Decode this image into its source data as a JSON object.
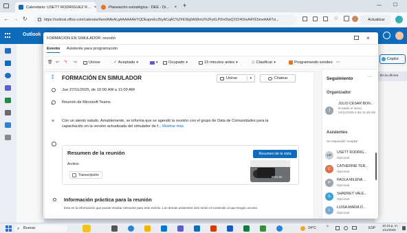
{
  "browser": {
    "tabs": [
      {
        "label": "Calendario: USETT RODRIGUEZ R…",
        "color": "#0f6cbd"
      },
      {
        "label": "Planeación estratégica - DEE - Di…",
        "color": "#e8731d"
      }
    ],
    "new_tab_glyph": "+",
    "window_controls": [
      "—",
      "☐"
    ],
    "url": "https://outlook.office.com/calendar/item/AAkALgAAAAAAHYQDEapmEv2byACqAC%2FEWg0A68mU%2FyKLP0mI5wQ15240XeAAYE5meAAA?ui...",
    "update_button": "Actualizar"
  },
  "outlook": {
    "app_name": "Outlook",
    "copilot_label": "Copilot",
    "office_label": "En la oficina"
  },
  "modal": {
    "title": "FORMACIÓN EN SIMULADOR: reunión",
    "tabs": [
      "Evento",
      "Asistente para programación"
    ],
    "toolbar": {
      "unirse": "Unirse",
      "aceptado": "Aceptado",
      "ocupado": "Ocupado",
      "recordatorio": "15 minutos antes",
      "clasificar": "Clasificar",
      "programando": "Programando sondeo",
      "more": "···"
    },
    "event_title": "FORMACIÓN EN SIMULADOR",
    "join_button": "Unirse",
    "chat_button": "Chatear",
    "datetime": "Jue 27/11/2025, de 10:00 AM a 11:00 AM",
    "location": "Reunión de Microsoft Teams",
    "body": "Con un atento saludo. Amablemente, se informa que se agendó la reunión con el grupo de Data de Comunidades para la capacitación en la versión actualizada del simulador de f...",
    "more_link": "Mostrar más",
    "recap": {
      "title": "Resumen de la reunión",
      "view_button": "Resumen de la vista",
      "files_label": "Archivo",
      "transcript_label": "Transcripción",
      "duration": "50m 4s"
    },
    "info": {
      "title": "Información práctica para la reunión",
      "text": "Esta es la información que puede resultar relevante para este evento. Los demás asistentes solo verán el contenido al que tengan acceso."
    }
  },
  "sidebar": {
    "title": "Seguimiento",
    "organizer_label": "Organizador",
    "organizer": {
      "initials": "J",
      "name": "JULIO CESAR BON...",
      "sent": "Enviado el lunes, 24/11/2025 a las 11:48 AM"
    },
    "attendees_label": "Asistentes",
    "attendees_sub": "Se respondió 'Aceptar'",
    "attendees": [
      {
        "initials": "UR",
        "name": "USETT RODRIG...",
        "role": "Opcional",
        "color": "#c7cdd4"
      },
      {
        "initials": "C",
        "name": "CATHERINE TER...",
        "role": "Opcional",
        "color": "#d8734c"
      },
      {
        "initials": "P",
        "name": "PAOLA MILENA ...",
        "role": "Opcional",
        "color": "#9aa4ad"
      },
      {
        "initials": "S",
        "name": "SHADREY VALE...",
        "role": "Opcional",
        "color": "#3aa0d6"
      },
      {
        "initials": "L",
        "name": "LUISA MARIA O...",
        "role": "Opcional",
        "color": "#7aa7d9"
      }
    ]
  },
  "taskbar": {
    "search": "Buscar",
    "temperature": "24°C",
    "lang": "ESP",
    "time": "10:15 p. m.",
    "date": "1/12/2025"
  }
}
